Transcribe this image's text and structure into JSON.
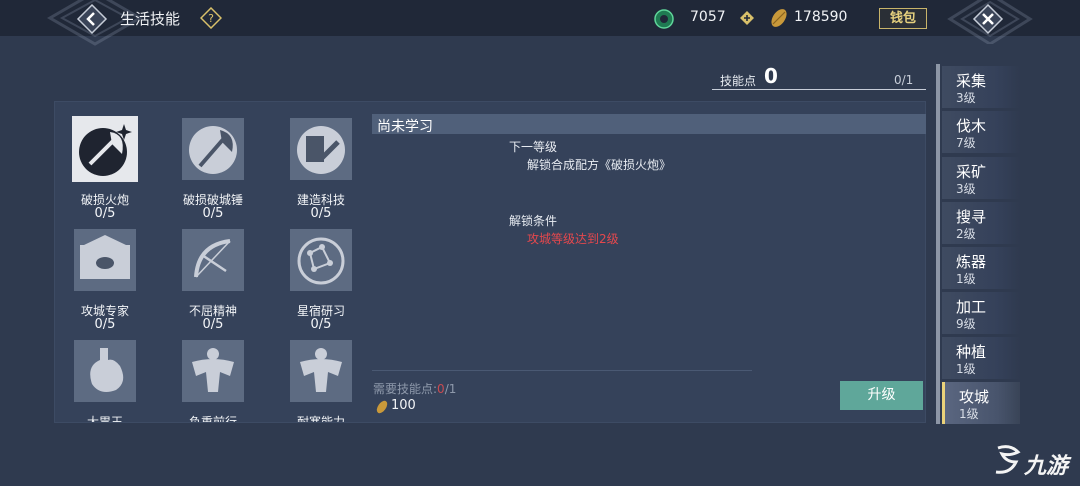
{
  "header": {
    "title": "生活技能",
    "gem_value": "7057",
    "coin_value": "178590",
    "wallet_label": "钱包"
  },
  "skill_points": {
    "label": "技能点",
    "value": "0",
    "fraction": "0/1"
  },
  "skills": [
    {
      "name": "破损火炮",
      "level": "0/5",
      "icon": "cannon-axe-icon"
    },
    {
      "name": "破损破城锤",
      "level": "0/5",
      "icon": "ram-hammer-icon"
    },
    {
      "name": "建造科技",
      "level": "0/5",
      "icon": "build-tech-icon"
    },
    {
      "name": "攻城专家",
      "level": "0/5",
      "icon": "siege-expert-icon"
    },
    {
      "name": "不屈精神",
      "level": "0/5",
      "icon": "bow-spirit-icon"
    },
    {
      "name": "星宿研习",
      "level": "0/5",
      "icon": "constellation-icon"
    },
    {
      "name": "大胃王",
      "level": "",
      "icon": "stomach-icon"
    },
    {
      "name": "负重前行",
      "level": "",
      "icon": "muscle-icon"
    },
    {
      "name": "耐寒能力",
      "level": "",
      "icon": "muscle-icon"
    }
  ],
  "detail": {
    "title": "尚未学习",
    "next_label": "下一等级",
    "next_text": "解锁合成配方《破损火炮》",
    "cond_label": "解锁条件",
    "cond_text": "攻城等级达到2级",
    "need_label": "需要技能点:",
    "need_current": "0",
    "need_total": "/1",
    "cost": "100",
    "upgrade_label": "升级"
  },
  "tabs": [
    {
      "name": "采集",
      "level": "3级"
    },
    {
      "name": "伐木",
      "level": "7级"
    },
    {
      "name": "采矿",
      "level": "3级"
    },
    {
      "name": "搜寻",
      "level": "2级"
    },
    {
      "name": "炼器",
      "level": "1级"
    },
    {
      "name": "加工",
      "level": "9级"
    },
    {
      "name": "种植",
      "level": "1级"
    },
    {
      "name": "攻城",
      "level": "1级",
      "active": true
    }
  ],
  "watermark": "九游",
  "colors": {
    "accent_gold": "#ead27a",
    "upgrade_green": "#5fa79a",
    "warning_red": "#e5484d"
  }
}
